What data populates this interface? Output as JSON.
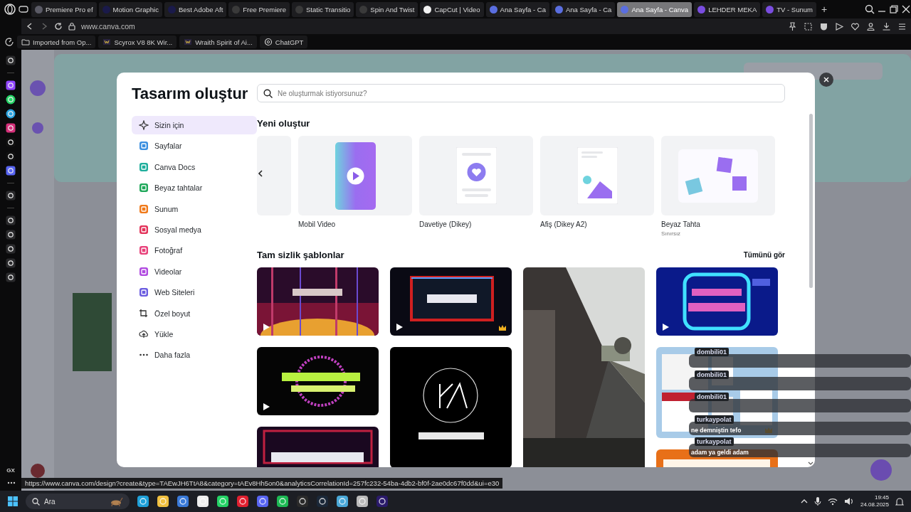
{
  "browser": {
    "tabs": [
      {
        "title": "Premiere Pro ef",
        "selected": false,
        "color": "#5b5b66"
      },
      {
        "title": "Motion Graphic",
        "selected": false,
        "color": "#1a1a4a"
      },
      {
        "title": "Best Adobe Aft",
        "selected": false,
        "color": "#1a1a4a"
      },
      {
        "title": "Free Premiere",
        "selected": false,
        "color": "#3a3a3a"
      },
      {
        "title": "Static Transitio",
        "selected": false,
        "color": "#3a3a3a"
      },
      {
        "title": "Spin And Twist",
        "selected": false,
        "color": "#3a3a3a"
      },
      {
        "title": "CapCut | Video",
        "selected": false,
        "color": "#f2f2f2"
      },
      {
        "title": "Ana Sayfa - Ca",
        "selected": false,
        "color": "#5a6ee0"
      },
      {
        "title": "Ana Sayfa - Ca",
        "selected": false,
        "color": "#5a6ee0"
      },
      {
        "title": "Ana Sayfa - Canva",
        "selected": true,
        "color": "#5a6ee0"
      },
      {
        "title": "LEHDER MEKA",
        "selected": false,
        "color": "#7a4de0"
      },
      {
        "title": "TV - Sunum",
        "selected": false,
        "color": "#7a4de0"
      }
    ],
    "new_tab": "+",
    "address": "www.canva.com",
    "bookmarks": [
      {
        "title": "Imported from Op..."
      },
      {
        "title": "Scyrox V8 8K Wir..."
      },
      {
        "title": "Wraith Spirit of Ai..."
      },
      {
        "title": "ChatGPT"
      }
    ],
    "sidebar_label": "GX",
    "status_url": "https://www.canva.com/design?create&type=TAEwJH6TtA8&category=tAEv8Hh5on0&analyticsCorrelationId=257fc232-54ba-4db2-bf0f-2ae0dc67f0dd&ui=e30"
  },
  "modal": {
    "title": "Tasarım oluştur",
    "search": {
      "placeholder": "Ne oluşturmak istiyorsunuz?"
    },
    "nav": [
      {
        "label": "Sizin için",
        "selected": true
      },
      {
        "label": "Sayfalar",
        "selected": false,
        "color": "#3b8fe0"
      },
      {
        "label": "Canva Docs",
        "selected": false,
        "color": "#1fae9c"
      },
      {
        "label": "Beyaz tahtalar",
        "selected": false,
        "color": "#1fa85a"
      },
      {
        "label": "Sunum",
        "selected": false,
        "color": "#f07a1a"
      },
      {
        "label": "Sosyal medya",
        "selected": false,
        "color": "#e3335a"
      },
      {
        "label": "Fotoğraf",
        "selected": false,
        "color": "#e8417a"
      },
      {
        "label": "Videolar",
        "selected": false,
        "color": "#b04ae0"
      },
      {
        "label": "Web Siteleri",
        "selected": false,
        "color": "#6a5ce0"
      },
      {
        "label": "Özel boyut",
        "selected": false
      },
      {
        "label": "Yükle",
        "selected": false
      },
      {
        "label": "Daha fazla",
        "selected": false
      }
    ],
    "create": {
      "heading": "Yeni oluştur",
      "cards": [
        {
          "kind": "partial"
        },
        {
          "kind": "video",
          "label": "Mobil Video"
        },
        {
          "kind": "invite",
          "label": "Davetiye (Dikey)"
        },
        {
          "kind": "poster",
          "label": "Afiş (Dikey A2)"
        },
        {
          "kind": "whiteboard",
          "label": "Beyaz Tahta",
          "sublabel": "Sınırsız"
        }
      ]
    },
    "templates": {
      "heading": "Tam sizlik şablonlar",
      "see_all": "Tümünü gör",
      "columns": [
        [
          {
            "kind": "picture",
            "video": true,
            "premium": false
          },
          {
            "kind": "picture",
            "video": true,
            "premium": false
          },
          {
            "kind": "picture",
            "video": false,
            "premium": false
          }
        ],
        [
          {
            "kind": "picture",
            "video": true,
            "premium": true
          },
          {
            "kind": "picture",
            "video": false,
            "premium": false
          }
        ],
        [
          {
            "kind": "picture",
            "video": false,
            "premium": false
          }
        ],
        [
          {
            "kind": "picture",
            "video": true,
            "premium": false
          },
          {
            "kind": "picture",
            "video": false,
            "premium": true
          },
          {
            "kind": "picture",
            "video": false,
            "premium": false
          }
        ]
      ]
    }
  },
  "chat_overlay": [
    {
      "user": "dombili01"
    },
    {
      "user": "dombili01"
    },
    {
      "user": "dombili01"
    },
    {
      "user": "turkaypolat",
      "message": "ne demniştin tefo"
    },
    {
      "user": "turkaypolat",
      "message": "adam ya geldi adam"
    }
  ],
  "taskbar": {
    "search": {
      "placeholder": "Ara"
    },
    "time": "19:45",
    "date": "24.08.2025"
  }
}
